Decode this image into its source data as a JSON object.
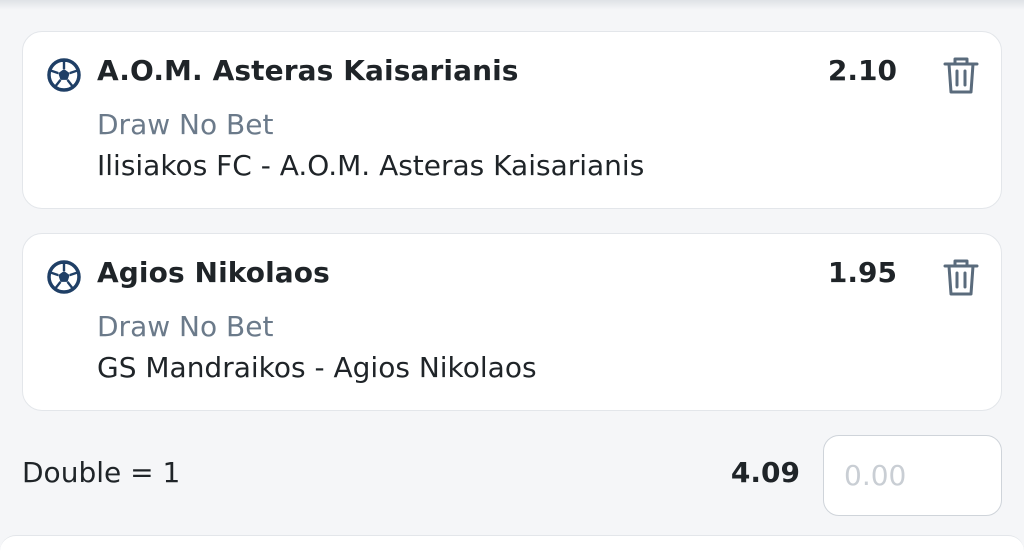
{
  "bets": [
    {
      "sport_icon": "soccer-ball-icon",
      "selection": "A.O.M. Asteras Kaisarianis",
      "odds": "2.10",
      "market": "Draw No Bet",
      "event": "Ilisiakos FC - A.O.M. Asteras Kaisarianis",
      "delete_icon": "trash-icon"
    },
    {
      "sport_icon": "soccer-ball-icon",
      "selection": "Agios Nikolaos",
      "odds": "1.95",
      "market": "Draw No Bet",
      "event": "GS Mandraikos - Agios Nikolaos",
      "delete_icon": "trash-icon"
    }
  ],
  "combo": {
    "label": "Double = 1",
    "total_odds": "4.09",
    "stake_value": "",
    "stake_placeholder": "0.00"
  },
  "colors": {
    "background": "#f5f6f8",
    "card": "#ffffff",
    "market_text": "#6b7a8a",
    "icon": "#1f3f66",
    "trash": "#5a6b7c"
  }
}
